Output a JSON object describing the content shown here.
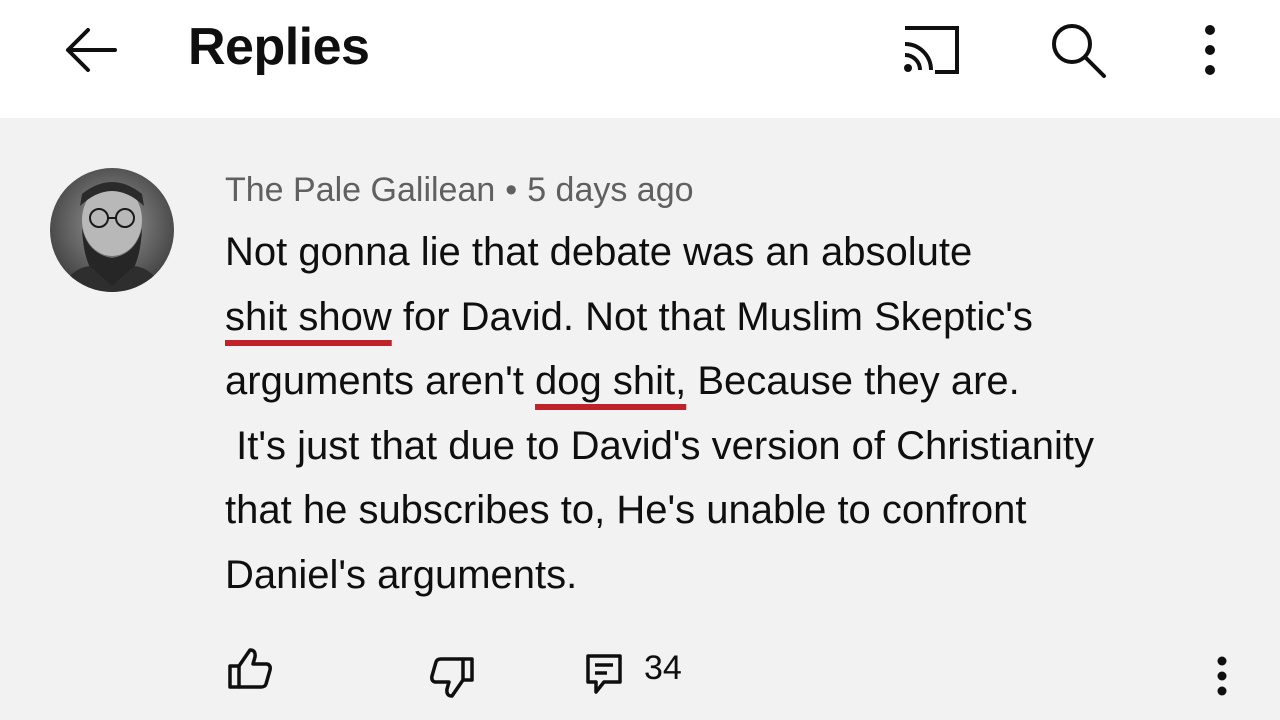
{
  "header": {
    "title": "Replies",
    "back_icon": "arrow-left-icon",
    "cast_icon": "cast-icon",
    "search_icon": "search-icon",
    "more_icon": "more-vert-icon"
  },
  "comment": {
    "author": "The Pale Galilean",
    "separator": "•",
    "time": "5 days ago",
    "text_lines": [
      [
        {
          "t": "Not gonna lie that debate was an absolute",
          "f": false
        }
      ],
      [
        {
          "t": "shit show",
          "f": true
        },
        {
          "t": " for David. Not that Muslim Skeptic's",
          "f": false
        }
      ],
      [
        {
          "t": "arguments aren't ",
          "f": false
        },
        {
          "t": "dog shit,",
          "f": true
        },
        {
          "t": " Because they are.",
          "f": false
        }
      ],
      [
        {
          "t": " It's just that due to David's version of Christianity",
          "f": false
        }
      ],
      [
        {
          "t": "that he subscribes to, He's unable to confront",
          "f": false
        }
      ],
      [
        {
          "t": "Daniel's arguments.",
          "f": false
        }
      ]
    ],
    "reply_count": "34",
    "underline_color": "#c0222c"
  },
  "colors": {
    "background": "#f2f2f2",
    "header_background": "#ffffff",
    "text": "#0f0f0f",
    "meta": "#606060"
  }
}
